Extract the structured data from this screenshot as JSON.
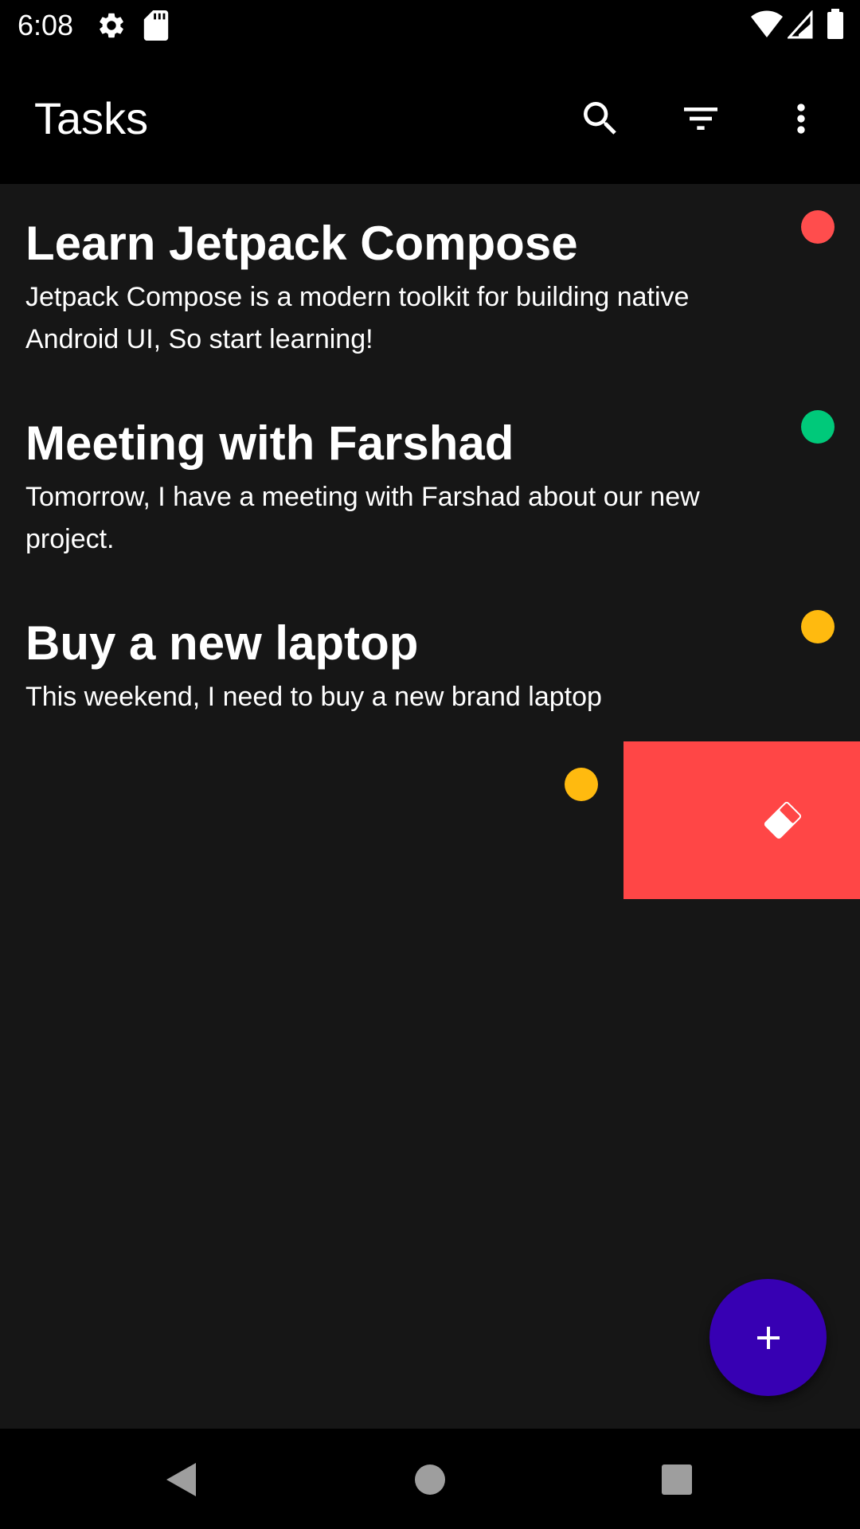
{
  "status_bar": {
    "time": "6:08",
    "icons": [
      "settings-icon",
      "sd-card-icon",
      "wifi-icon",
      "cell-signal-icon",
      "battery-icon"
    ]
  },
  "app_bar": {
    "title": "Tasks",
    "actions": [
      "search-icon",
      "filter-icon",
      "more-vert-icon"
    ]
  },
  "tasks": [
    {
      "title": "Learn Jetpack Compose",
      "description": "Jetpack Compose is a modern toolkit for building native Android UI, So start learning!",
      "priority_color": "#ff4d4d"
    },
    {
      "title": "Meeting with Farshad",
      "description": "Tomorrow, I have a meeting with Farshad about our new project.",
      "priority_color": "#00c97a"
    },
    {
      "title": "Buy a new laptop",
      "description": "This weekend, I need to buy a new brand laptop",
      "priority_color": "#ffba0f"
    },
    {
      "title": "",
      "description": "",
      "priority_color": "#ffba0f",
      "swiped": true
    }
  ],
  "swipe_action": {
    "icon": "eraser-icon",
    "background_color": "#ff4646"
  },
  "fab": {
    "icon": "add-icon",
    "color": "#3700b3"
  },
  "nav_bar": {
    "buttons": [
      "back-icon",
      "home-icon",
      "recents-icon"
    ]
  }
}
